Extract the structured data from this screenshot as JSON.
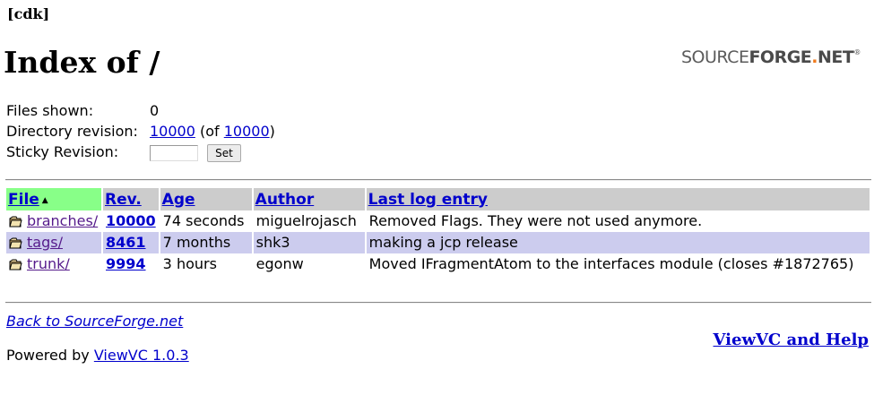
{
  "header": {
    "repo_name": "[cdk]",
    "page_title": "Index of /",
    "logo": {
      "part1": "SOURCE",
      "part2": "FORGE",
      "dot": ".",
      "part3": "NET",
      "reg": "®"
    }
  },
  "info": {
    "files_shown_label": "Files shown:",
    "files_shown_value": "0",
    "dir_rev_label": "Directory revision:",
    "dir_rev_value": "10000",
    "dir_rev_of_prefix": "(of ",
    "dir_rev_of_value": "10000",
    "dir_rev_of_suffix": ")",
    "sticky_label": "Sticky Revision:",
    "sticky_value": "",
    "set_button": "Set"
  },
  "table": {
    "headers": {
      "file": "File",
      "rev": "Rev.",
      "age": "Age",
      "author": "Author",
      "log": "Last log entry"
    },
    "rows": [
      {
        "name": "branches/",
        "rev": "10000",
        "age": "74 seconds",
        "author": "miguelrojasch",
        "log": "Removed Flags. They were not used anymore."
      },
      {
        "name": "tags/",
        "rev": "8461",
        "age": "7 months",
        "author": "shk3",
        "log": "making a jcp release"
      },
      {
        "name": "trunk/",
        "rev": "9994",
        "age": "3 hours",
        "author": "egonw",
        "log": "Moved IFragmentAtom to the interfaces module (closes #1872765)"
      }
    ]
  },
  "footer": {
    "back_link": "Back to SourceForge.net",
    "powered_prefix": "Powered by ",
    "powered_link": "ViewVC 1.0.3",
    "help_link": "ViewVC and Help"
  },
  "colors": {
    "sorted_header": "#88ff88",
    "header_bg": "#cccccc",
    "alt_row": "#ccccee",
    "link": "#0000cc",
    "visited_link": "#551a8b"
  }
}
